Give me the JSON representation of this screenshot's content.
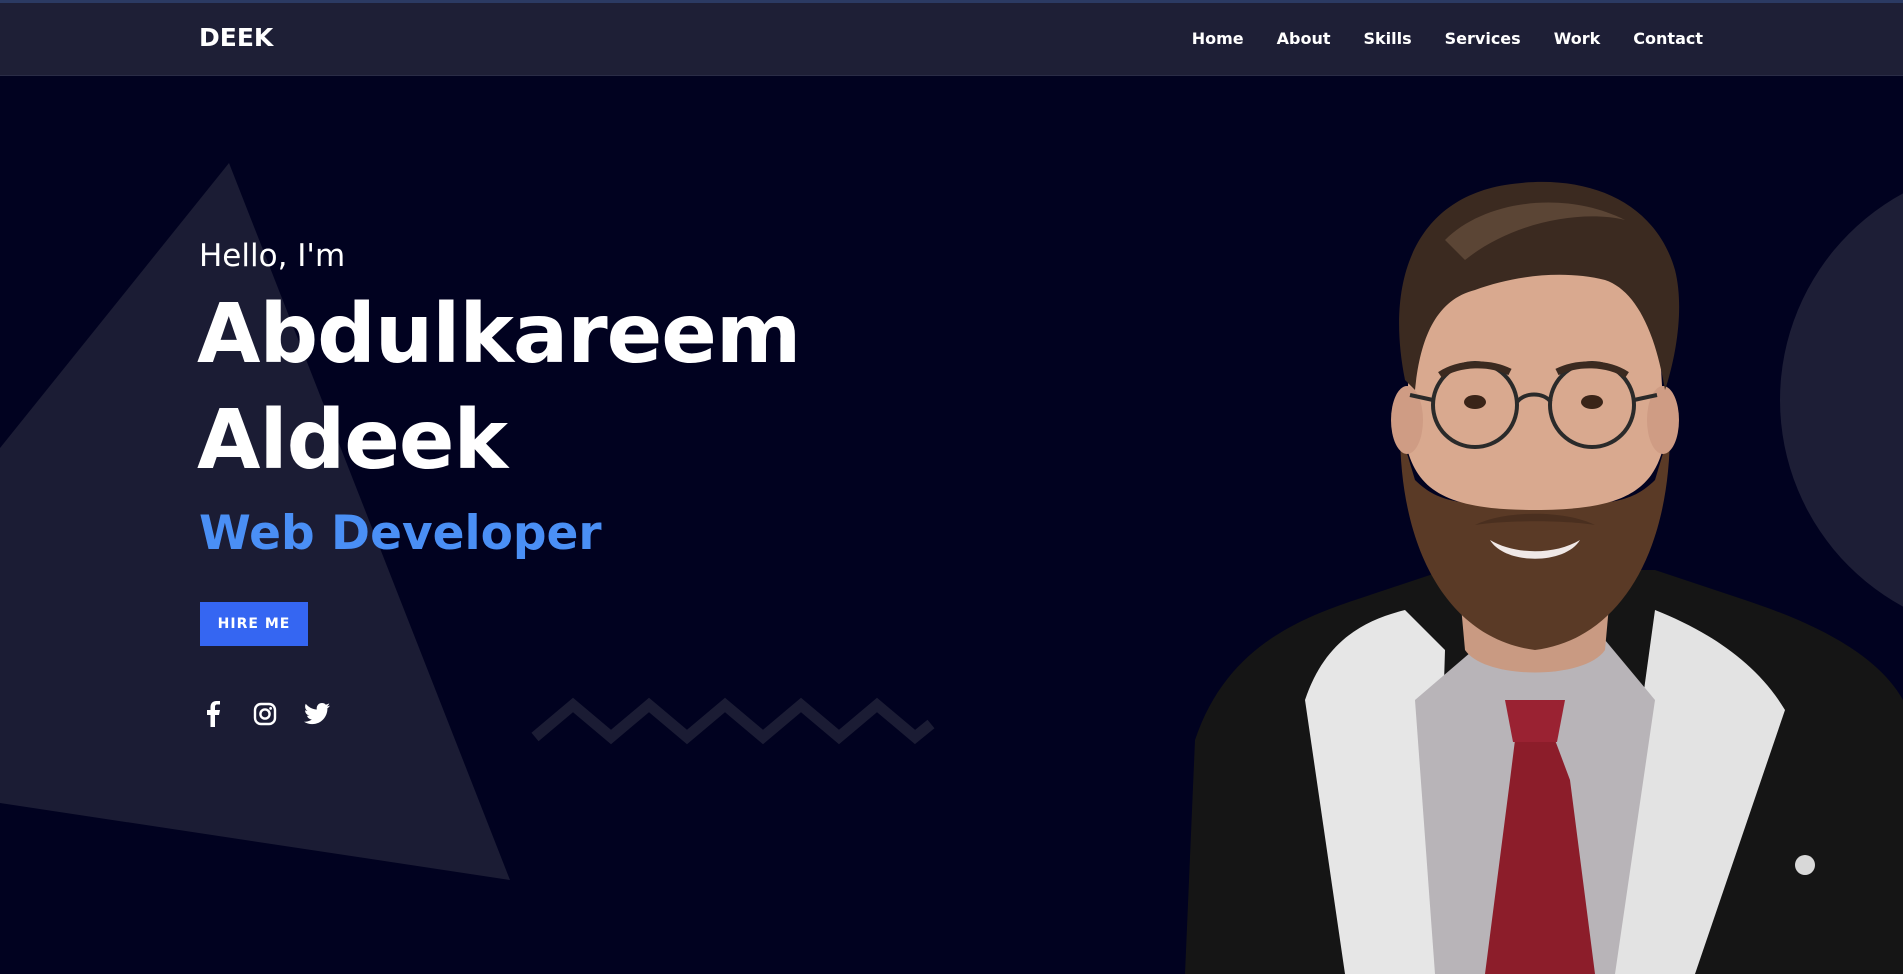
{
  "nav": {
    "logo": "DEEK",
    "links": [
      "Home",
      "About",
      "Skills",
      "Services",
      "Work",
      "Contact"
    ]
  },
  "hero": {
    "greeting": "Hello, I'm",
    "name_line1": "Abdulkareem",
    "name_line2": "Aldeek",
    "role": "Web Developer",
    "hire_button": "HIRE ME"
  },
  "socials": [
    "facebook-icon",
    "instagram-icon",
    "twitter-icon"
  ],
  "colors": {
    "background": "#010220",
    "navbar": "#1e1f36",
    "accent": "#4a8ff5",
    "button": "#3566f2",
    "shape": "#1c1d35"
  }
}
